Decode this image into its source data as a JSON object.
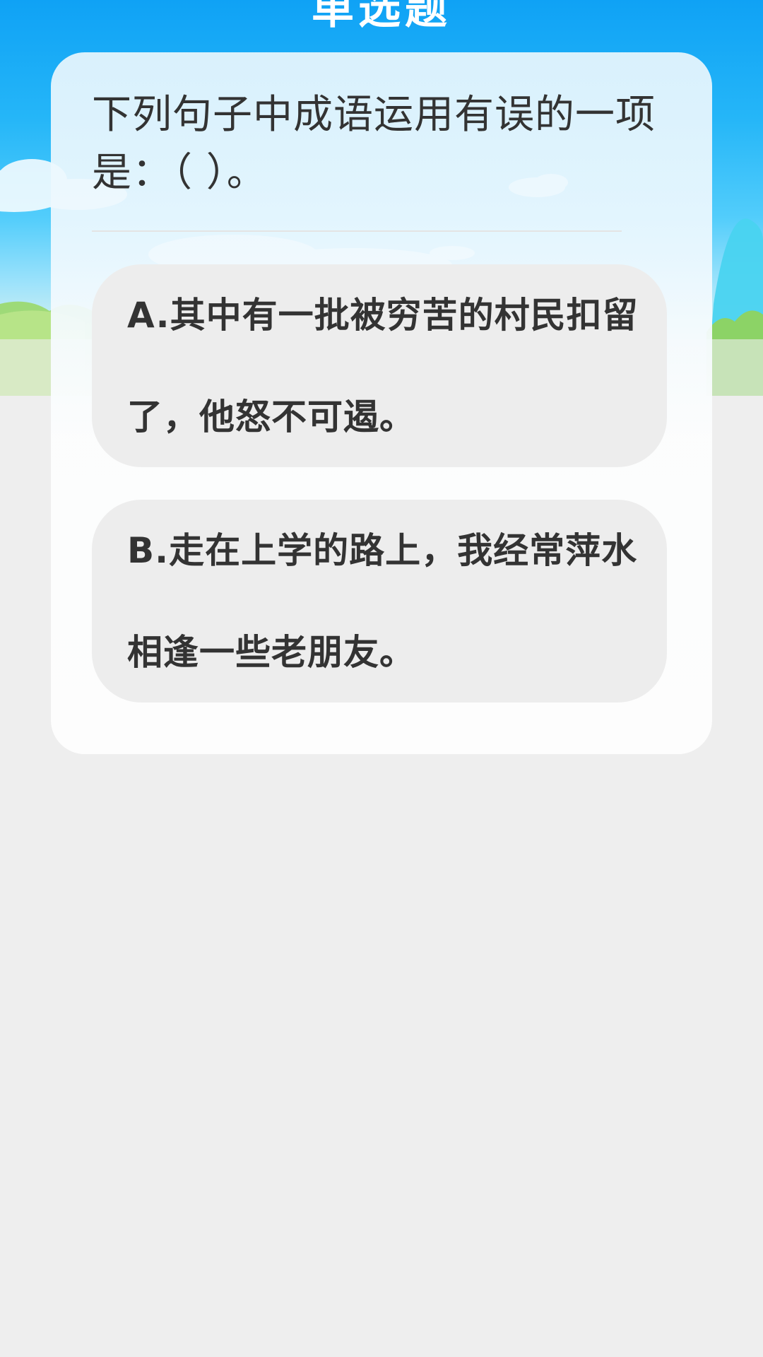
{
  "header": {
    "title": "单选题"
  },
  "question": {
    "text": "下列句子中成语运用有误的一项是：（ ）。"
  },
  "options": [
    {
      "label": "A.其中有一批被穷苦的村民扣留了，他怒不可遏。"
    },
    {
      "label": "B.走在上学的路上，我经常萍水相逢一些老朋友。"
    }
  ],
  "colors": {
    "sky_top": "#0fa2f5",
    "card_bg": "#fdfdfd",
    "option_bg": "#ededed",
    "text": "#333333",
    "page_bg": "#eeeeee"
  }
}
